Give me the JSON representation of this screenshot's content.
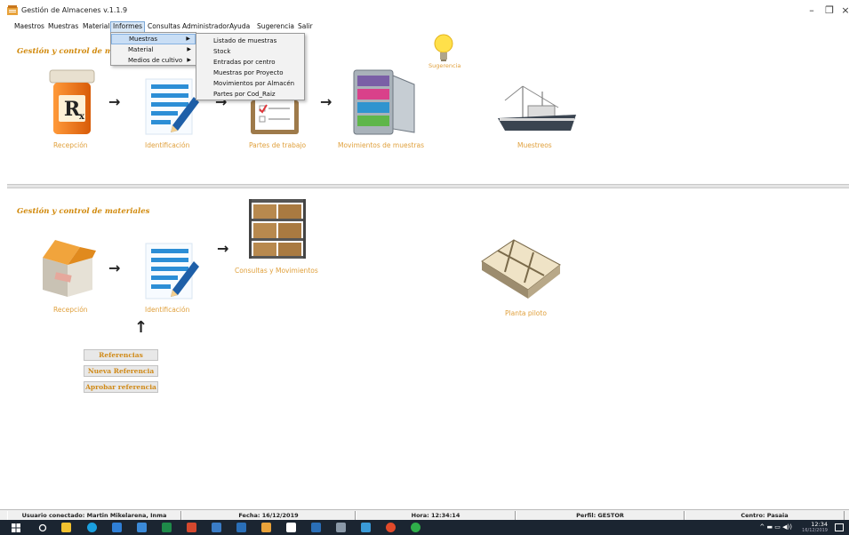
{
  "window": {
    "title": "Gestión de Almacenes v.1.1.9",
    "controls": [
      "–",
      "❐",
      "×"
    ]
  },
  "menubar": {
    "items": [
      "Maestros",
      "Muestras",
      "Material",
      "Informes",
      "Consultas",
      "Administrador",
      "Ayuda",
      "Sugerencia",
      "Salir"
    ],
    "active": "Informes"
  },
  "informes_menu": {
    "items": [
      "Muestras",
      "Material",
      "Medios de cultivo"
    ],
    "highlighted": "Muestras"
  },
  "muestras_submenu": {
    "items": [
      "Listado de muestras",
      "Stock",
      "Entradas por centro",
      "Muestras por Proyecto",
      "Movimientos por Almacén",
      "Partes por Cod_Raiz"
    ]
  },
  "muestras_panel": {
    "title": "Gestión y control de mues",
    "recepcion": "Recepción",
    "identificacion": "Identificación",
    "partes": "Partes de trabajo",
    "movimientos": "Movimientos de muestras",
    "muestreos": "Muestreos",
    "sugerencia": "Sugerencia"
  },
  "materiales_panel": {
    "title": "Gestión y control de materiales",
    "recepcion": "Recepción",
    "identificacion": "Identificación",
    "consultas": "Consultas y Movimientos",
    "planta": "Planta piloto",
    "buttons": {
      "referencias": "Referencias",
      "nueva": "Nueva Referencia",
      "aprobar": "Aprobar referencia"
    }
  },
  "statusbar": {
    "usuario": "Usuario conectado: Martin Mikelarena, Inma",
    "fecha": "Fecha: 16/12/2019",
    "hora": "Hora: 12:34:14",
    "perfil": "Perfil: GESTOR",
    "centro": "Centro: Pasaia"
  },
  "taskbar": {
    "time": "12:34",
    "date": "16/12/2019"
  },
  "colors": {
    "accent_title": "#d1890b",
    "caption": "#e0a03c",
    "taskbar": "#1b2531"
  }
}
